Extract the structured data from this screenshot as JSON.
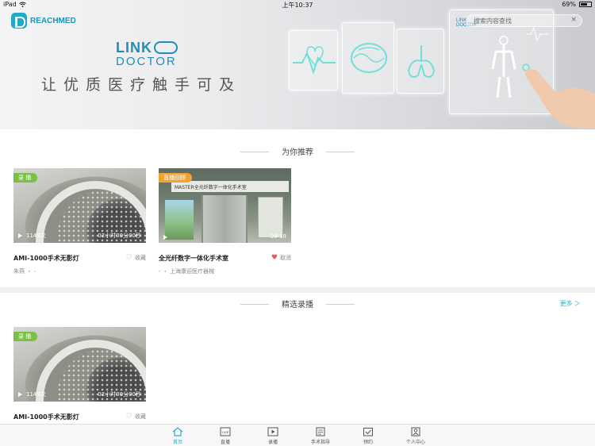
{
  "status_bar": {
    "device": "iPad",
    "time": "上午10:37",
    "battery": "69%",
    "battery_level": 0.69
  },
  "brand": {
    "logo_text": "REACHMED",
    "product_line1": "LINK",
    "product_line2": "DOCTOR",
    "slogan": "让优质医疗触手可及",
    "panel_text": "LINK DOCTOR"
  },
  "search": {
    "placeholder": "搜索内容查找",
    "clear": "×"
  },
  "recommend": {
    "title": "为你推荐",
    "cards": [
      {
        "badge": "录 播",
        "views": "1149次",
        "duration": "02小时00分00秒",
        "title": "AMI-1000手术无影灯",
        "fav_label": "收藏",
        "subtitle": "朱燕 ・ -"
      },
      {
        "badge": "直播回顾",
        "views": "",
        "duration": "09-18",
        "sign_text": "MASTER全光纤数字一体化手术室",
        "title": "全光纤数字一体化手术室",
        "fav_label": "取消",
        "subtitle": "- ・ 上海康迎医疗器械"
      }
    ]
  },
  "featured": {
    "title": "精选录播",
    "more": "更多 ＞",
    "cards": [
      {
        "badge": "录 播",
        "views": "1149次",
        "duration": "02小时00分00秒",
        "title": "AMI-1000手术无影灯",
        "fav_label": "收藏"
      }
    ]
  },
  "tabs": [
    {
      "label": "首页",
      "icon": "home-icon",
      "active": true
    },
    {
      "label": "直播",
      "icon": "live-icon",
      "active": false
    },
    {
      "label": "录播",
      "icon": "video-icon",
      "active": false
    },
    {
      "label": "手术指导",
      "icon": "guide-icon",
      "active": false
    },
    {
      "label": "预约",
      "icon": "calendar-check-icon",
      "active": false
    },
    {
      "label": "个人中心",
      "icon": "profile-icon",
      "active": false
    }
  ],
  "colors": {
    "accent": "#2ab0c6",
    "badge_record": "#7ac143",
    "badge_replay": "#f2a431",
    "heart_active": "#e95858"
  }
}
